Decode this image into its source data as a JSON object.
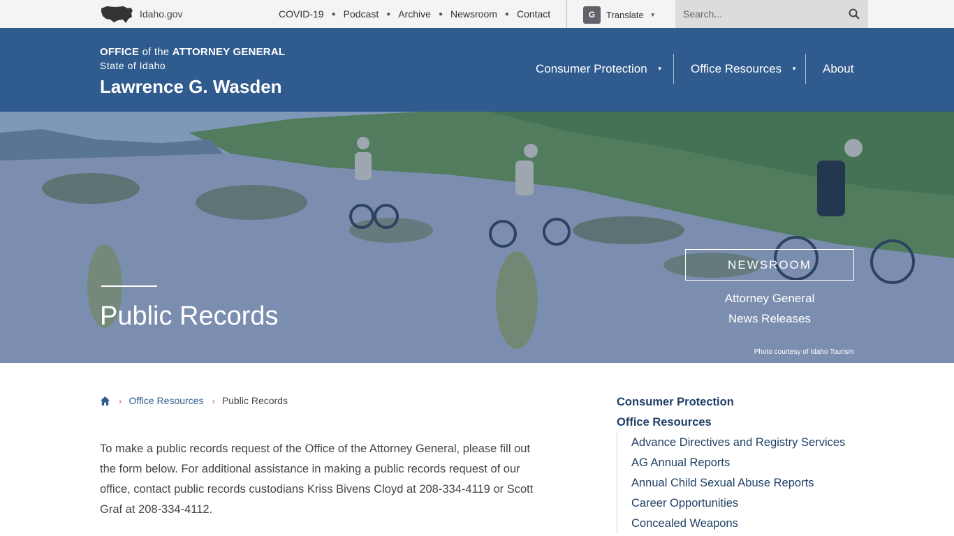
{
  "utility_bar": {
    "logo_text": "Idaho.gov",
    "links": [
      "COVID-19",
      "Podcast",
      "Archive",
      "Newsroom",
      "Contact"
    ],
    "translate_label": "Translate",
    "search_placeholder": "Search..."
  },
  "header": {
    "office_strong_1": "OFFICE",
    "office_mid": " of the ",
    "office_strong_2": "ATTORNEY GENERAL",
    "state": "State of Idaho",
    "name": "Lawrence G. Wasden",
    "nav": [
      {
        "label": "Consumer Protection",
        "has_dropdown": true
      },
      {
        "label": "Office Resources",
        "has_dropdown": true
      },
      {
        "label": "About",
        "has_dropdown": false
      }
    ]
  },
  "hero": {
    "title": "Public Records",
    "newsroom_label": "NEWSROOM",
    "newsroom_link_1": "Attorney General",
    "newsroom_link_2": "News Releases",
    "photo_credit": "Photo courtesy of Idaho Tourism"
  },
  "breadcrumb": {
    "items": [
      "Office Resources",
      "Public Records"
    ]
  },
  "intro_text": "To make a public records request of the Office of the Attorney General, please fill out the form below. For additional assistance in making a public records request of our office, contact public records custodians Kriss Bivens Cloyd at 208-334-4119 or Scott Graf at 208-334-4112.",
  "sidenav": {
    "top_items": [
      "Consumer Protection",
      "Office Resources"
    ],
    "sub_items": [
      "Advance Directives and Registry Services",
      "AG Annual Reports",
      "Annual Child Sexual Abuse Reports",
      "Career Opportunities",
      "Concealed Weapons"
    ]
  },
  "colors": {
    "brand_blue": "#2f5b8e",
    "utility_bg": "#f4f4f4",
    "search_bg": "#dcdcdc",
    "link_dark": "#1f3f66"
  }
}
